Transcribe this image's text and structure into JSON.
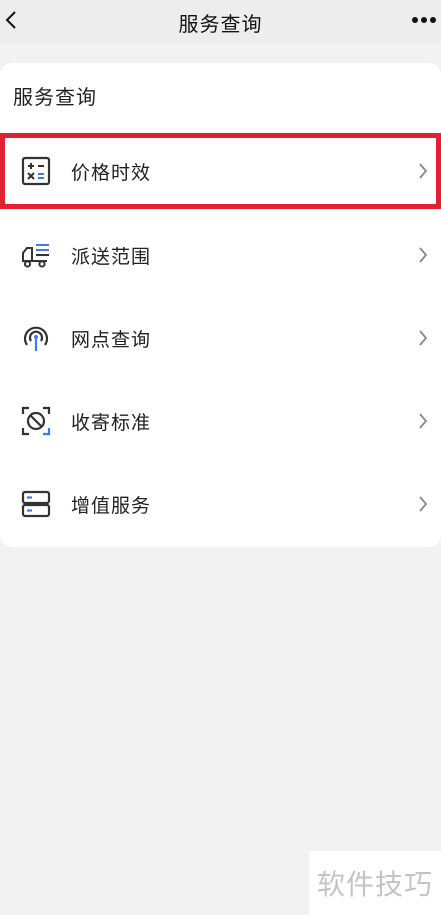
{
  "nav": {
    "title": "服务查询",
    "back_icon": "chevron-left-icon",
    "more_icon": "more-dots-icon"
  },
  "section": {
    "title": "服务查询"
  },
  "items": [
    {
      "label": "价格时效",
      "icon": "calculator-icon",
      "highlighted": true
    },
    {
      "label": "派送范围",
      "icon": "delivery-truck-icon",
      "highlighted": false
    },
    {
      "label": "网点查询",
      "icon": "location-signal-icon",
      "highlighted": false
    },
    {
      "label": "收寄标准",
      "icon": "prohibited-icon",
      "highlighted": false
    },
    {
      "label": "增值服务",
      "icon": "server-icon",
      "highlighted": false
    }
  ],
  "colors": {
    "accent": "#3d7ce8",
    "highlight": "#e3202f",
    "icon": "#333333"
  },
  "watermark": "软件技巧"
}
